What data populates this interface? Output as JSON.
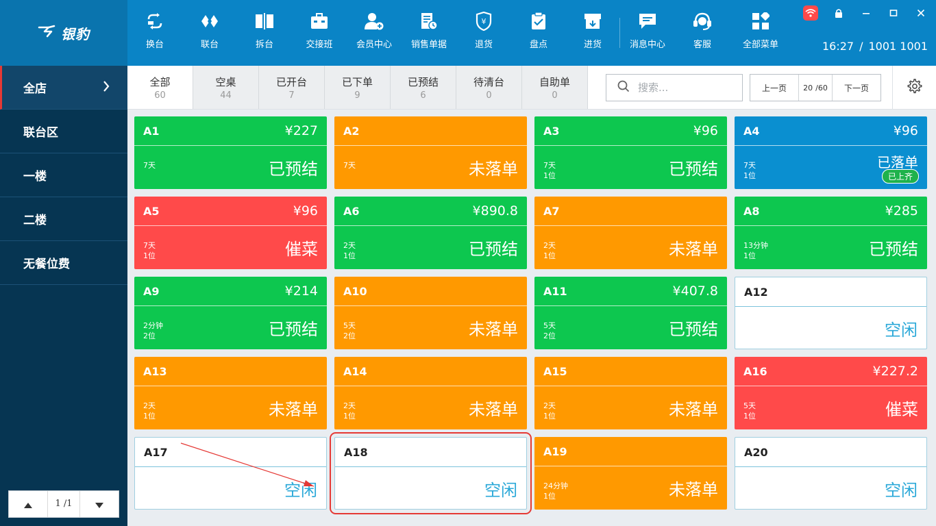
{
  "app": {
    "logo_text": "银豹",
    "clock_time": "16:27",
    "clock_sep": "/",
    "clock_user": "1001 1001"
  },
  "toolbar": [
    {
      "label": "换台",
      "icon": "swap-table-icon",
      "w": 80
    },
    {
      "label": "联台",
      "icon": "link-table-icon",
      "w": 80
    },
    {
      "label": "拆台",
      "icon": "split-table-icon",
      "w": 80
    },
    {
      "label": "交接班",
      "icon": "shift-handover-icon",
      "w": 80
    },
    {
      "label": "会员中心",
      "icon": "member-center-icon",
      "w": 80
    },
    {
      "label": "销售单据",
      "icon": "sales-receipt-icon",
      "w": 80
    },
    {
      "label": "退货",
      "icon": "return-icon",
      "w": 80
    },
    {
      "label": "盘点",
      "icon": "inventory-check-icon",
      "w": 80
    },
    {
      "label": "进货",
      "icon": "purchase-icon",
      "w": 78
    },
    {
      "label": "消息中心",
      "icon": "message-center-icon",
      "w": 80
    },
    {
      "label": "客服",
      "icon": "customer-service-icon",
      "w": 80
    },
    {
      "label": "全部菜单",
      "icon": "all-menu-icon",
      "w": 90
    }
  ],
  "sidebar": {
    "items": [
      {
        "label": "全店",
        "active": true
      },
      {
        "label": "联台区",
        "active": false
      },
      {
        "label": "一楼",
        "active": false
      },
      {
        "label": "二楼",
        "active": false
      },
      {
        "label": "无餐位费",
        "active": false
      }
    ],
    "pager_text": "1 /1"
  },
  "tabs": [
    {
      "label": "全部",
      "count": "60",
      "active": true
    },
    {
      "label": "空桌",
      "count": "44",
      "active": false
    },
    {
      "label": "已开台",
      "count": "7",
      "active": false
    },
    {
      "label": "已下单",
      "count": "9",
      "active": false
    },
    {
      "label": "已预结",
      "count": "6",
      "active": false
    },
    {
      "label": "待清台",
      "count": "0",
      "active": false
    },
    {
      "label": "自助单",
      "count": "0",
      "active": false
    }
  ],
  "search": {
    "placeholder": "搜索..."
  },
  "pager": {
    "prev": "上一页",
    "current": "20",
    "sep": "/60",
    "next": "下一页"
  },
  "colors": {
    "green": "#0dc74f",
    "orange": "#ff9900",
    "red": "#ff4a4a",
    "blue": "#0a8fd0",
    "idle_text": "#2aa8d8",
    "topbar": "#0a84c6",
    "sidebar": "#063552"
  },
  "tables": [
    {
      "name": "A1",
      "amount": "¥227",
      "status": "已预结",
      "color": "green",
      "meta": [
        "7天"
      ]
    },
    {
      "name": "A2",
      "amount": "",
      "status": "未落单",
      "color": "orange",
      "meta": [
        "7天"
      ]
    },
    {
      "name": "A3",
      "amount": "¥96",
      "status": "已预结",
      "color": "green",
      "meta": [
        "7天",
        "1位"
      ]
    },
    {
      "name": "A4",
      "amount": "¥96",
      "status": "已落单",
      "color": "blue",
      "meta": [
        "7天",
        "1位"
      ],
      "badge": "已上齐"
    },
    {
      "name": "A5",
      "amount": "¥96",
      "status": "催菜",
      "color": "red",
      "meta": [
        "7天",
        "1位"
      ]
    },
    {
      "name": "A6",
      "amount": "¥890.8",
      "status": "已预结",
      "color": "green",
      "meta": [
        "2天",
        "1位"
      ]
    },
    {
      "name": "A7",
      "amount": "",
      "status": "未落单",
      "color": "orange",
      "meta": [
        "2天",
        "1位"
      ]
    },
    {
      "name": "A8",
      "amount": "¥285",
      "status": "已预结",
      "color": "green",
      "meta": [
        "13分钟",
        "1位"
      ]
    },
    {
      "name": "A9",
      "amount": "¥214",
      "status": "已预结",
      "color": "green",
      "meta": [
        "2分钟",
        "2位"
      ]
    },
    {
      "name": "A10",
      "amount": "",
      "status": "未落单",
      "color": "orange",
      "meta": [
        "5天",
        "2位"
      ]
    },
    {
      "name": "A11",
      "amount": "¥407.8",
      "status": "已预结",
      "color": "green",
      "meta": [
        "5天",
        "2位"
      ]
    },
    {
      "name": "A12",
      "amount": "",
      "status": "空闲",
      "color": "idle",
      "meta": []
    },
    {
      "name": "A13",
      "amount": "",
      "status": "未落单",
      "color": "orange",
      "meta": [
        "2天",
        "1位"
      ]
    },
    {
      "name": "A14",
      "amount": "",
      "status": "未落单",
      "color": "orange",
      "meta": [
        "2天",
        "1位"
      ]
    },
    {
      "name": "A15",
      "amount": "",
      "status": "未落单",
      "color": "orange",
      "meta": [
        "2天",
        "1位"
      ]
    },
    {
      "name": "A16",
      "amount": "¥227.2",
      "status": "催菜",
      "color": "red",
      "meta": [
        "5天",
        "1位"
      ]
    },
    {
      "name": "A17",
      "amount": "",
      "status": "空闲",
      "color": "idle",
      "meta": []
    },
    {
      "name": "A18",
      "amount": "",
      "status": "空闲",
      "color": "idle",
      "meta": [],
      "highlighted": true
    },
    {
      "name": "A19",
      "amount": "",
      "status": "未落单",
      "color": "orange",
      "meta": [
        "24分钟",
        "1位"
      ]
    },
    {
      "name": "A20",
      "amount": "",
      "status": "空闲",
      "color": "idle",
      "meta": []
    }
  ]
}
